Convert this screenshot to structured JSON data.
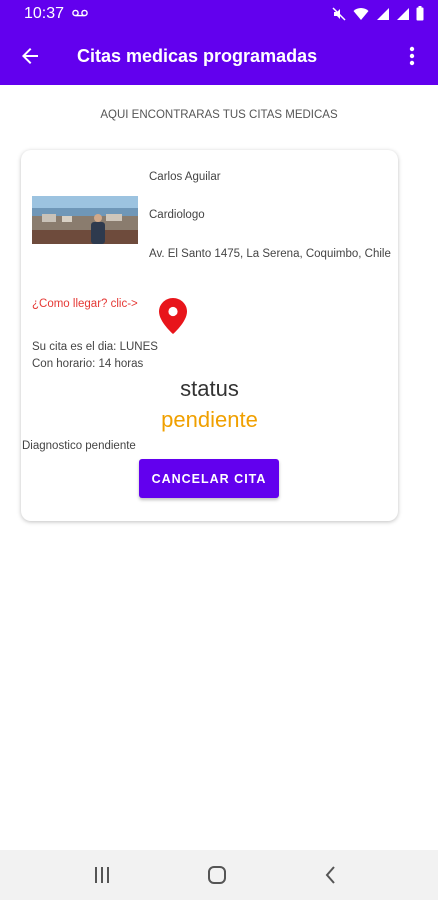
{
  "status_bar": {
    "time": "10:37"
  },
  "app_bar": {
    "title": "Citas medicas programadas",
    "back_icon": "arrow-back-icon",
    "menu_icon": "more-vert-icon"
  },
  "subtitle": "AQUI ENCONTRARAS TUS CITAS MEDICAS",
  "appointment": {
    "doctor_name": "Carlos Aguilar",
    "specialty": "Cardiologo",
    "address": "Av. El Santo 1475, La Serena, Coquimbo, Chile",
    "directions_link": "¿Como llegar? clic->",
    "day_text": "Su cita es el dia: LUNES",
    "hour_text": "Con horario: 14 horas",
    "status_label": "status",
    "status_value": "pendiente",
    "diagnosis": "Diagnostico pendiente",
    "cancel_label": "CANCELAR CITA"
  },
  "colors": {
    "primary": "#6200ee",
    "link": "#e53935",
    "status": "#f0a000"
  }
}
